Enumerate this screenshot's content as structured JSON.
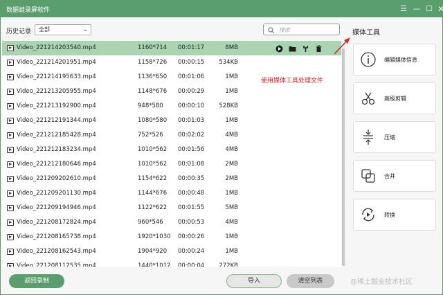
{
  "window": {
    "title": "数据蛙录屏软件",
    "controls": [
      "menu",
      "minimize",
      "maximize",
      "close"
    ]
  },
  "toolbar": {
    "history_label": "历史记录",
    "filter_value": "全部",
    "search_placeholder": "搜索"
  },
  "annotation": "使用媒体工具处理文件",
  "files": [
    {
      "name": "Video_221214203540.mp4",
      "resolution": "1160*714",
      "duration": "00:01:17",
      "size": "8MB",
      "selected": true
    },
    {
      "name": "Video_221214201951.mp4",
      "resolution": "1158*726",
      "duration": "00:00:15",
      "size": "534KB"
    },
    {
      "name": "Video_221214195633.mp4",
      "resolution": "1136*650",
      "duration": "00:01:06",
      "size": "1MB"
    },
    {
      "name": "Video_221213205955.mp4",
      "resolution": "1148*676",
      "duration": "00:00:29",
      "size": "1MB"
    },
    {
      "name": "Video_221213192900.mp4",
      "resolution": "948*580",
      "duration": "00:00:10",
      "size": "528KB"
    },
    {
      "name": "Video_221212191344.mp4",
      "resolution": "1080*580",
      "duration": "00:01:03",
      "size": "1MB"
    },
    {
      "name": "Video_221212185428.mp4",
      "resolution": "752*526",
      "duration": "00:02:02",
      "size": "4MB"
    },
    {
      "name": "Video_221212183234.mp4",
      "resolution": "1010*562",
      "duration": "00:01:56",
      "size": "4MB"
    },
    {
      "name": "Video_221212180646.mp4",
      "resolution": "1010*562",
      "duration": "00:01:08",
      "size": "2MB"
    },
    {
      "name": "Video_221209202610.mp4",
      "resolution": "1154*622",
      "duration": "00:00:35",
      "size": "2MB"
    },
    {
      "name": "Video_221209201130.mp4",
      "resolution": "1144*676",
      "duration": "00:00:48",
      "size": "1MB"
    },
    {
      "name": "Video_221209194946.mp4",
      "resolution": "1122*622",
      "duration": "00:01:55",
      "size": "5MB"
    },
    {
      "name": "Video_221208172824.mp4",
      "resolution": "960*546",
      "duration": "00:00:53",
      "size": "4MB"
    },
    {
      "name": "Video_221208165738.mp4",
      "resolution": "1920*1030",
      "duration": "00:00:26",
      "size": "1MB"
    },
    {
      "name": "Video_221208162543.mp4",
      "resolution": "1904*920",
      "duration": "00:00:24",
      "size": "1MB"
    },
    {
      "name": "Video_221208112535.mp4",
      "resolution": "1440*1012",
      "duration": "00:00:04",
      "size": "272KB"
    }
  ],
  "row_actions": [
    "play-icon",
    "folder-icon",
    "tool-icon",
    "delete-icon"
  ],
  "media_tools": {
    "title": "媒体工具",
    "items": [
      {
        "label": "编辑媒体信息",
        "icon": "info-icon"
      },
      {
        "label": "高级剪辑",
        "icon": "scissors-icon"
      },
      {
        "label": "压缩",
        "icon": "compress-icon"
      },
      {
        "label": "合并",
        "icon": "merge-icon"
      },
      {
        "label": "转换",
        "icon": "convert-icon"
      }
    ]
  },
  "footer": {
    "back_label": "返回录制",
    "import_label": "导入",
    "clear_label": "清空列表"
  },
  "watermark": "@稀土掘金技术社区",
  "colors": {
    "accent": "#5b9e6d",
    "selected_row": "#a9d3b1",
    "annotation": "#e02020"
  }
}
